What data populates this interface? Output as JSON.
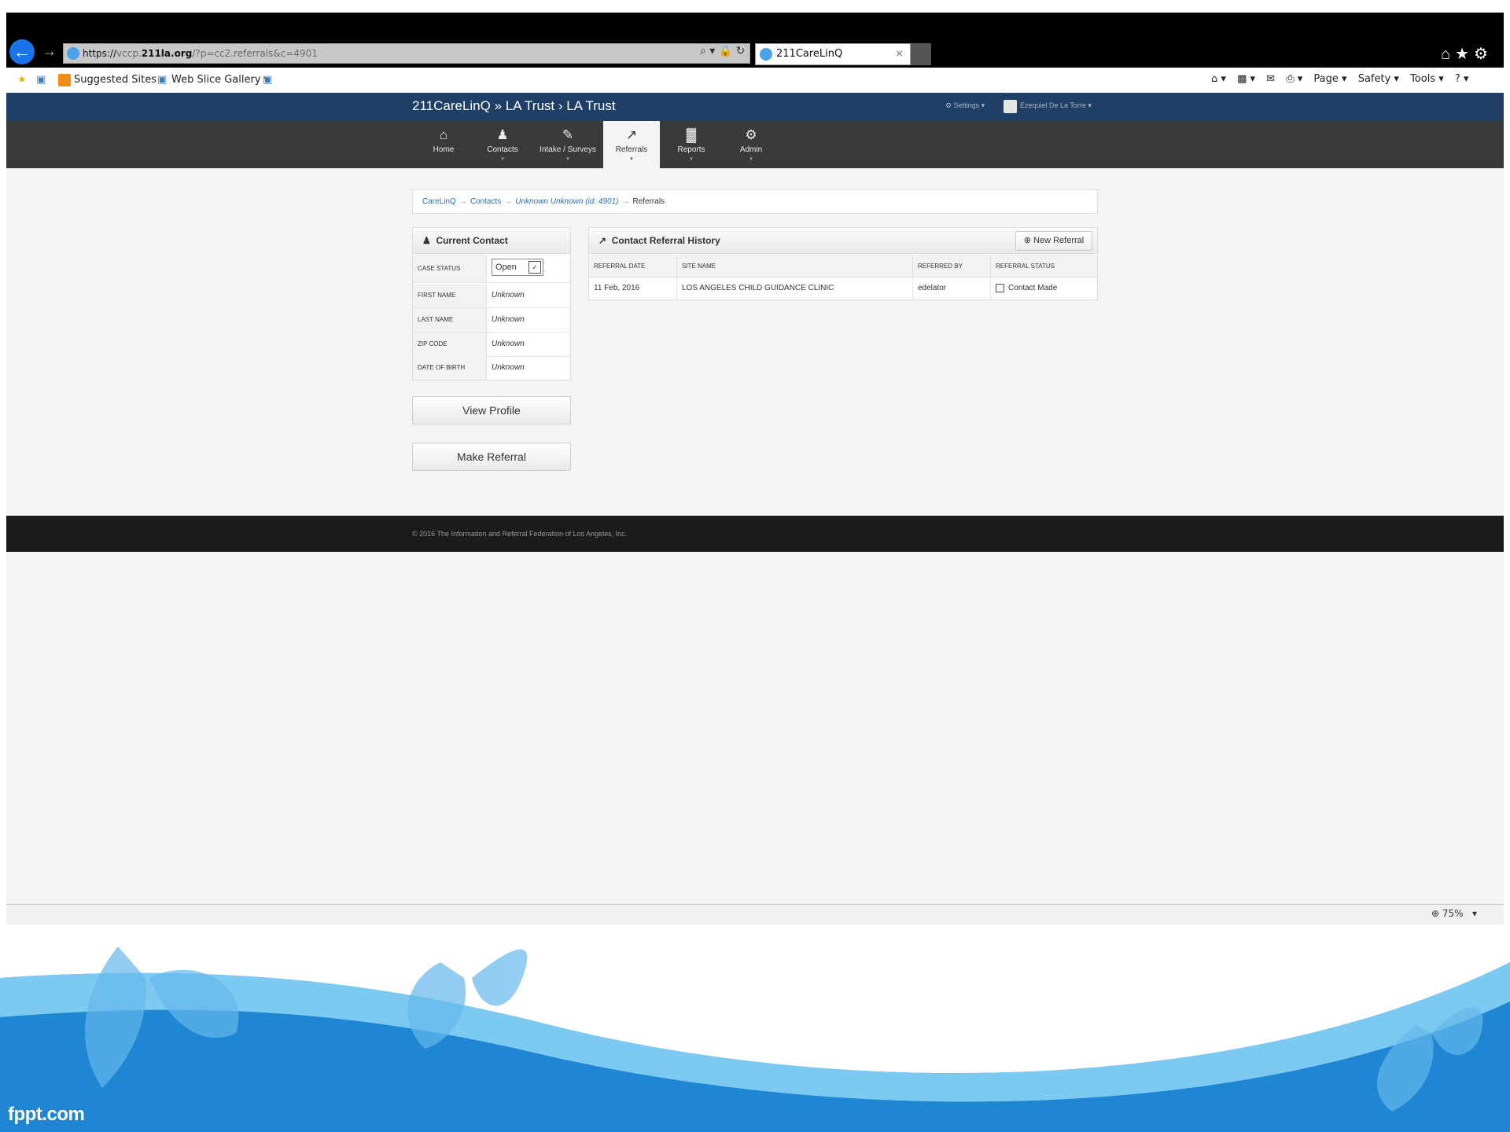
{
  "browser": {
    "url_scheme": "https://",
    "url_pre": "vccp.",
    "url_domain": "211la.org",
    "url_path": "/?p=cc2.referrals&c=4901",
    "addr_tools": "⌕ ▾ 🔒 ↻",
    "tab_title": "211CareLinQ",
    "tab_close": "×",
    "win_icons": "⌂★⚙",
    "favorites": {
      "suggested_sites": "Suggested Sites ▾",
      "web_slice_gallery": "Web Slice Gallery ▾"
    },
    "cmdbar": {
      "page": "Page ▾",
      "safety": "Safety ▾",
      "tools": "Tools ▾",
      "help": "? ▾"
    },
    "zoom": "75%"
  },
  "app": {
    "brand": "211CareLinQ » LA Trust › LA Trust",
    "settings": "⚙ Settings ▾",
    "user": "Ezequiel De La Torre ▾",
    "nav": [
      {
        "label": "Home",
        "icon": "⌂",
        "caret": ""
      },
      {
        "label": "Contacts",
        "icon": "♟",
        "caret": "▾"
      },
      {
        "label": "Intake / Surveys",
        "icon": "✎",
        "caret": "▾"
      },
      {
        "label": "Referrals",
        "icon": "↗",
        "caret": "▾"
      },
      {
        "label": "Reports",
        "icon": "▓",
        "caret": "▾"
      },
      {
        "label": "Admin",
        "icon": "⚙",
        "caret": "▾"
      }
    ],
    "breadcrumb": {
      "root": "CareLinQ",
      "contacts": "Contacts",
      "contact": "Unknown Unknown (id: 4901)",
      "current": "Referrals",
      "sep": "→"
    },
    "current_contact": {
      "title": "Current Contact",
      "case_status_label": "CASE STATUS",
      "case_status_value": "Open",
      "fields": [
        {
          "label": "FIRST NAME",
          "value": "Unknown"
        },
        {
          "label": "LAST NAME",
          "value": "Unknown"
        },
        {
          "label": "ZIP CODE",
          "value": "Unknown"
        },
        {
          "label": "DATE OF BIRTH",
          "value": "Unknown"
        }
      ],
      "view_profile": "View Profile",
      "make_referral": "Make Referral"
    },
    "history": {
      "title": "Contact Referral History",
      "new_referral": "New Referral",
      "columns": [
        "REFERRAL DATE",
        "SITE NAME",
        "REFERRED BY",
        "REFERRAL STATUS"
      ],
      "rows": [
        {
          "date": "11 Feb, 2016",
          "site": "LOS ANGELES CHILD GUIDANCE CLINIC",
          "by": "edelator",
          "status": "Contact Made"
        }
      ]
    },
    "footer": "© 2016 The Information and Referral Federation of Los Angeles, Inc."
  },
  "slide": {
    "site_credit": "fppt.com"
  }
}
